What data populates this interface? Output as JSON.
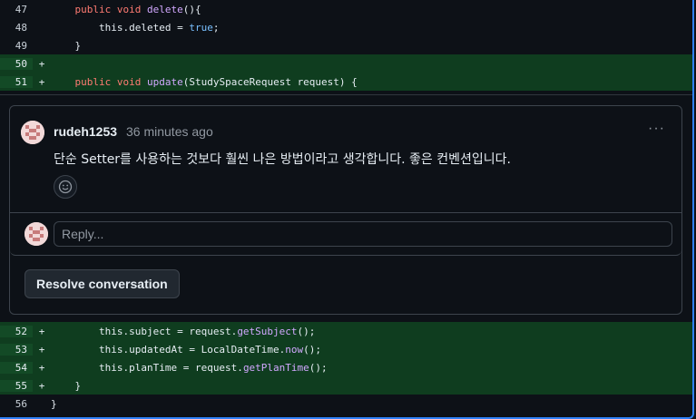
{
  "diff_top": [
    {
      "line": "47",
      "marker": "",
      "type": "ctx",
      "indent": "    ",
      "tokens": [
        [
          "kw",
          "public "
        ],
        [
          "kw",
          "void "
        ],
        [
          "fn",
          "delete"
        ],
        [
          "id",
          "(){"
        ]
      ]
    },
    {
      "line": "48",
      "marker": "",
      "type": "ctx",
      "indent": "        ",
      "tokens": [
        [
          "id",
          "this.deleted = "
        ],
        [
          "lit",
          "true"
        ],
        [
          "id",
          ";"
        ]
      ]
    },
    {
      "line": "49",
      "marker": "",
      "type": "ctx",
      "indent": "    ",
      "tokens": [
        [
          "id",
          "}"
        ]
      ]
    },
    {
      "line": "50",
      "marker": "+",
      "type": "add",
      "indent": "",
      "tokens": []
    },
    {
      "line": "51",
      "marker": "+",
      "type": "add",
      "indent": "    ",
      "tokens": [
        [
          "kw",
          "public "
        ],
        [
          "kw",
          "void "
        ],
        [
          "fn",
          "update"
        ],
        [
          "id",
          "(StudySpaceRequest request) {"
        ]
      ]
    }
  ],
  "comment": {
    "author": "rudeh1253",
    "time": "36 minutes ago",
    "body": "단순 Setter를 사용하는 것보다 훨씬 나은 방법이라고 생각합니다. 좋은 컨벤션입니다.",
    "more_label": "···"
  },
  "reply": {
    "placeholder": "Reply..."
  },
  "resolve": {
    "label": "Resolve conversation"
  },
  "diff_bottom": [
    {
      "line": "52",
      "marker": "+",
      "type": "add",
      "indent": "        ",
      "tokens": [
        [
          "id",
          "this.subject = request."
        ],
        [
          "fn",
          "getSubject"
        ],
        [
          "id",
          "();"
        ]
      ]
    },
    {
      "line": "53",
      "marker": "+",
      "type": "add",
      "indent": "        ",
      "tokens": [
        [
          "id",
          "this.updatedAt = LocalDateTime."
        ],
        [
          "fn",
          "now"
        ],
        [
          "id",
          "();"
        ]
      ]
    },
    {
      "line": "54",
      "marker": "+",
      "type": "add",
      "indent": "        ",
      "tokens": [
        [
          "id",
          "this.planTime = request."
        ],
        [
          "fn",
          "getPlanTime"
        ],
        [
          "id",
          "();"
        ]
      ]
    },
    {
      "line": "55",
      "marker": "+",
      "type": "add",
      "indent": "    ",
      "tokens": [
        [
          "id",
          "}"
        ]
      ]
    },
    {
      "line": "56",
      "marker": "",
      "type": "ctx",
      "indent": "",
      "tokens": [
        [
          "id",
          "}"
        ]
      ]
    }
  ],
  "colors": {
    "accent": "#2f81f7",
    "added_bg": "#0f3d1f"
  }
}
